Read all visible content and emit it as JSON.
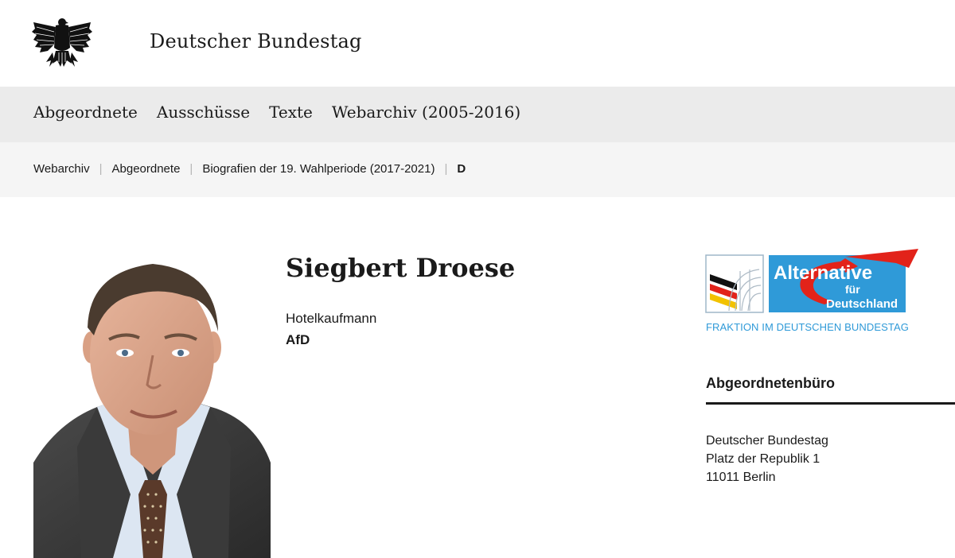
{
  "header": {
    "site_title": "Deutscher Bundestag",
    "logo_icon": "federal-eagle-icon"
  },
  "mainnav": {
    "items": [
      {
        "label": "Abgeordnete"
      },
      {
        "label": "Ausschüsse"
      },
      {
        "label": "Texte"
      },
      {
        "label": "Webarchiv (2005-2016)"
      }
    ]
  },
  "breadcrumb": {
    "items": [
      {
        "label": "Webarchiv"
      },
      {
        "label": "Abgeordnete"
      },
      {
        "label": "Biografien der 19. Wahlperiode (2017-2021)"
      },
      {
        "label": "D"
      }
    ]
  },
  "profile": {
    "name": "Siegbert Droese",
    "profession": "Hotelkaufmann",
    "party": "AfD"
  },
  "sidebar": {
    "logo_text_main": "Alternative",
    "logo_text_fuer": "für",
    "logo_text_land": "Deutschland",
    "logo_caption": "FRAKTION IM DEUTSCHEN BUNDESTAG",
    "office_heading": "Abgeordnetenbüro",
    "address": {
      "line1": "Deutscher Bundestag",
      "line2": "Platz der Republik 1",
      "line3": "11011 Berlin"
    }
  },
  "colors": {
    "nav_bg": "#ebebeb",
    "breadcrumb_bg": "#f5f5f5",
    "afd_blue": "#2f9ad8",
    "afd_red": "#e2231a"
  }
}
